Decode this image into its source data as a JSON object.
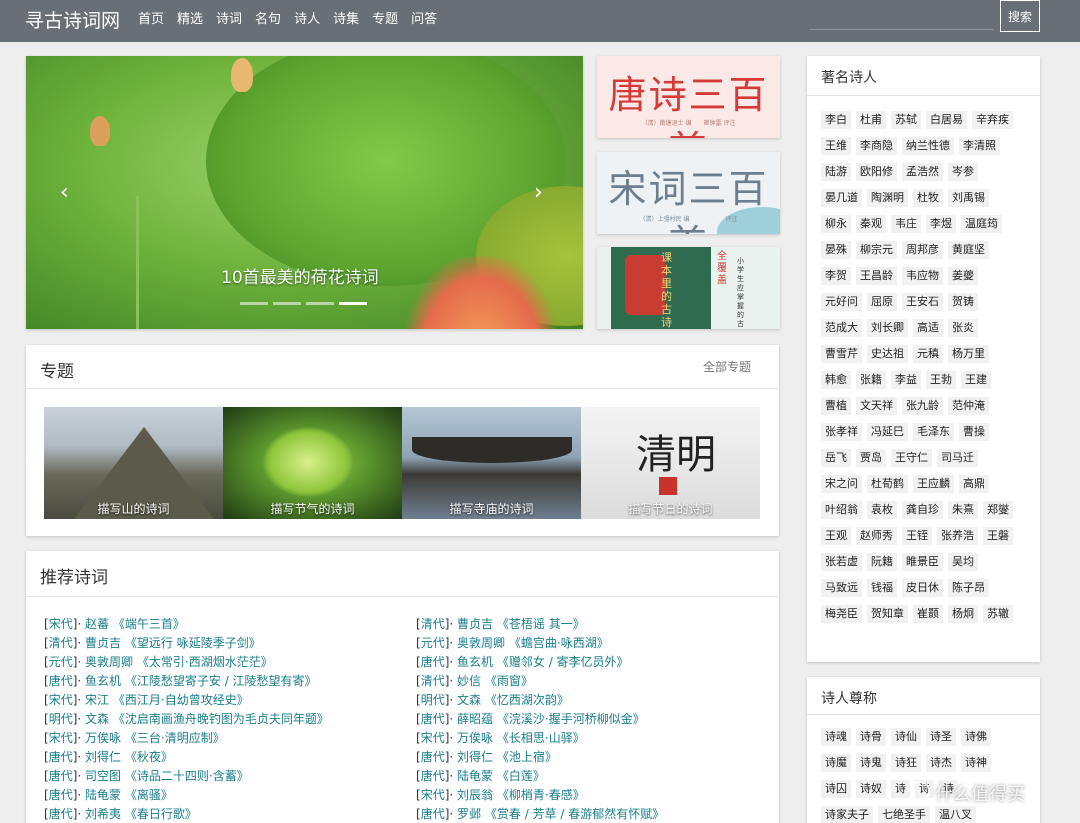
{
  "header": {
    "brand": "寻古诗词网",
    "nav": [
      "首页",
      "精选",
      "诗词",
      "名句",
      "诗人",
      "诗集",
      "专题",
      "问答"
    ],
    "search_placeholder": "",
    "search_button": "搜索"
  },
  "carousel": {
    "caption": "10首最美的荷花诗词",
    "prev_icon": "‹",
    "next_icon": "›",
    "active_index": 3,
    "slide_count": 4
  },
  "books": [
    {
      "title": "唐诗三百首",
      "subtitle": "（清）蘅塘退士 编　　崔钟雷 评注"
    },
    {
      "title": "宋词三百首",
      "subtitle": "（清）上彊村民 编　　　　　　评注"
    },
    {
      "title": "课本里的古诗词",
      "side": "小学生应掌握的古诗词",
      "badge": "全覆盖"
    }
  ],
  "topics": {
    "title": "专题",
    "more": "全部专题",
    "items": [
      {
        "label": "描写山的诗词"
      },
      {
        "label": "描写节气的诗词"
      },
      {
        "label": "描写寺庙的诗词"
      },
      {
        "label": "描写节日的诗词",
        "art_text": "清明"
      }
    ]
  },
  "recommend": {
    "title": "推荐诗词",
    "left": [
      {
        "dynasty": "宋代",
        "author": "赵蕃",
        "title": "《端午三首》"
      },
      {
        "dynasty": "清代",
        "author": "曹贞吉",
        "title": "《望远行 咏延陵季子剑》"
      },
      {
        "dynasty": "元代",
        "author": "奥敦周卿",
        "title": "《太常引·西湖烟水茫茫》"
      },
      {
        "dynasty": "唐代",
        "author": "鱼玄机",
        "title": "《江陵愁望寄子安 / 江陵愁望有寄》"
      },
      {
        "dynasty": "宋代",
        "author": "宋江",
        "title": "《西江月·自幼曾攻经史》"
      },
      {
        "dynasty": "明代",
        "author": "文森",
        "title": "《沈启南画渔舟晚钓图为毛贞夫同年题》"
      },
      {
        "dynasty": "宋代",
        "author": "万俟咏",
        "title": "《三台·清明应制》"
      },
      {
        "dynasty": "唐代",
        "author": "刘得仁",
        "title": "《秋夜》"
      },
      {
        "dynasty": "唐代",
        "author": "司空图",
        "title": "《诗品二十四则·含蓄》"
      },
      {
        "dynasty": "唐代",
        "author": "陆龟蒙",
        "title": "《离骚》"
      },
      {
        "dynasty": "唐代",
        "author": "刘希夷",
        "title": "《春日行歌》"
      }
    ],
    "right": [
      {
        "dynasty": "清代",
        "author": "曹贞吉",
        "title": "《苍梧谣 其一》"
      },
      {
        "dynasty": "元代",
        "author": "奥敦周卿",
        "title": "《蟾宫曲·咏西湖》"
      },
      {
        "dynasty": "唐代",
        "author": "鱼玄机",
        "title": "《赠邻女 / 寄李亿员外》"
      },
      {
        "dynasty": "清代",
        "author": "妙信",
        "title": "《雨窗》"
      },
      {
        "dynasty": "明代",
        "author": "文森",
        "title": "《忆西湖次韵》"
      },
      {
        "dynasty": "唐代",
        "author": "薛昭蕴",
        "title": "《浣溪沙·握手河桥柳似金》"
      },
      {
        "dynasty": "宋代",
        "author": "万俟咏",
        "title": "《长相思·山驿》"
      },
      {
        "dynasty": "唐代",
        "author": "刘得仁",
        "title": "《池上宿》"
      },
      {
        "dynasty": "唐代",
        "author": "陆龟蒙",
        "title": "《白莲》"
      },
      {
        "dynasty": "宋代",
        "author": "刘辰翁",
        "title": "《柳梢青·春感》"
      },
      {
        "dynasty": "唐代",
        "author": "罗邺",
        "title": "《赏春 / 芳草 / 春游郁然有怀赋》"
      }
    ]
  },
  "poets": {
    "title": "著名诗人",
    "rows": [
      [
        "李白",
        "杜甫",
        "苏轼",
        "白居易",
        "辛弃疾"
      ],
      [
        "王维",
        "李商隐",
        "纳兰性德",
        "李清照"
      ],
      [
        "陆游",
        "欧阳修",
        "孟浩然",
        "岑参"
      ],
      [
        "晏几道",
        "陶渊明",
        "杜牧",
        "刘禹锡"
      ],
      [
        "柳永",
        "秦观",
        "韦庄",
        "李煜",
        "温庭筠"
      ],
      [
        "晏殊",
        "柳宗元",
        "周邦彦",
        "黄庭坚"
      ],
      [
        "李贺",
        "王昌龄",
        "韦应物",
        "姜夔"
      ],
      [
        "元好问",
        "屈原",
        "王安石",
        "贺铸"
      ],
      [
        "范成大",
        "刘长卿",
        "高适",
        "张炎"
      ],
      [
        "曹雪芹",
        "史达祖",
        "元稹",
        "杨万里"
      ],
      [
        "韩愈",
        "张籍",
        "李益",
        "王勃",
        "王建"
      ],
      [
        "曹植",
        "文天祥",
        "张九龄",
        "范仲淹"
      ],
      [
        "张孝祥",
        "冯延巳",
        "毛泽东",
        "曹操"
      ],
      [
        "岳飞",
        "贾岛",
        "王守仁",
        "司马迁"
      ],
      [
        "宋之问",
        "杜荀鹤",
        "王应麟",
        "高鼎"
      ],
      [
        "叶绍翁",
        "袁枚",
        "龚自珍",
        "朱熹",
        "郑燮"
      ],
      [
        "王观",
        "赵师秀",
        "王铚",
        "张养浩",
        "王磐"
      ],
      [
        "张若虚",
        "阮籍",
        "睢景臣",
        "吴均"
      ],
      [
        "马致远",
        "钱福",
        "皮日休",
        "陈子昂"
      ],
      [
        "梅尧臣",
        "贺知章",
        "崔颢",
        "杨炯",
        "苏辙"
      ]
    ]
  },
  "honors": {
    "title": "诗人尊称",
    "rows": [
      [
        "诗魂",
        "诗骨",
        "诗仙",
        "诗圣",
        "诗佛"
      ],
      [
        "诗魔",
        "诗鬼",
        "诗狂",
        "诗杰",
        "诗神"
      ],
      [
        "诗囚",
        "诗奴",
        "诗",
        "诗",
        "诗"
      ],
      [
        "诗家夫子",
        "七绝圣手",
        "温八叉"
      ]
    ]
  },
  "watermark": "什么值得买"
}
